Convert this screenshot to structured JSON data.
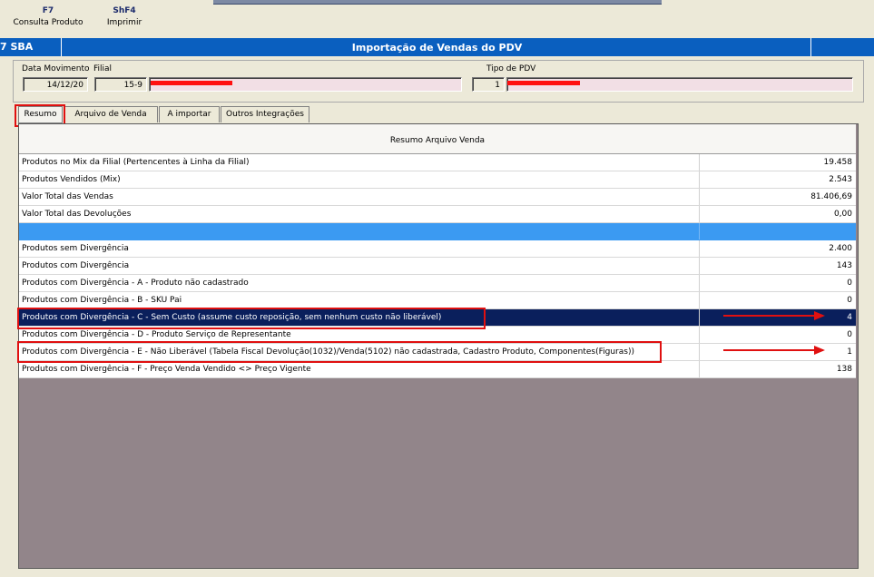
{
  "toolbar": {
    "buttons": [
      {
        "key": "F7",
        "label": "Consulta Produto"
      },
      {
        "key": "ShF4",
        "label": "Imprimir"
      }
    ]
  },
  "window": {
    "app_code": "7 SBA",
    "title": "Importação de Vendas do PDV"
  },
  "header": {
    "data_movimento_label": "Data Movimento",
    "data_movimento_value": "14/12/20",
    "filial_label": "Filial",
    "filial_value": "15-9",
    "tipo_pdv_label": "Tipo de PDV",
    "tipo_pdv_value": "1"
  },
  "tabs": [
    {
      "label": "Resumo",
      "active": true
    },
    {
      "label": "Arquivo de Venda",
      "active": false
    },
    {
      "label": "A importar",
      "active": false
    },
    {
      "label": "Outros Integrações",
      "active": false
    }
  ],
  "table": {
    "header": "Resumo Arquivo Venda",
    "rows": [
      {
        "label": "Produtos no Mix da Filial (Pertencentes à Linha da Filial)",
        "value": "19.458"
      },
      {
        "label": "Produtos Vendidos (Mix)",
        "value": "2.543"
      },
      {
        "label": "Valor Total das Vendas",
        "value": "81.406,69"
      },
      {
        "label": "Valor Total das Devoluções",
        "value": "0,00"
      },
      {
        "label": "",
        "value": ""
      },
      {
        "label": "Produtos sem Divergência",
        "value": "2.400"
      },
      {
        "label": "Produtos com Divergência",
        "value": "143"
      },
      {
        "label": "Produtos com Divergência - A - Produto não cadastrado",
        "value": "0"
      },
      {
        "label": "Produtos com Divergência - B - SKU Pai",
        "value": "0"
      },
      {
        "label": "Produtos com Divergência - C - Sem Custo (assume custo reposição, sem nenhum custo não liberável)",
        "value": "4"
      },
      {
        "label": "Produtos com Divergência - D - Produto Serviço de Representante",
        "value": "0"
      },
      {
        "label": "Produtos com Divergência - E - Não Liberável (Tabela Fiscal Devolução(1032)/Venda(5102) não cadastrada, Cadastro Produto, Componentes(Figuras))",
        "value": "1"
      },
      {
        "label": "Produtos com Divergência - F - Preço Venda Vendido <> Preço Vigente",
        "value": "138"
      }
    ]
  },
  "colors": {
    "titlebar": "#0a5fbf",
    "selected_row": "#0a1f5c",
    "separator_row": "#3b9af2",
    "annotation": "#e01010",
    "empty_grid": "#92858a"
  }
}
